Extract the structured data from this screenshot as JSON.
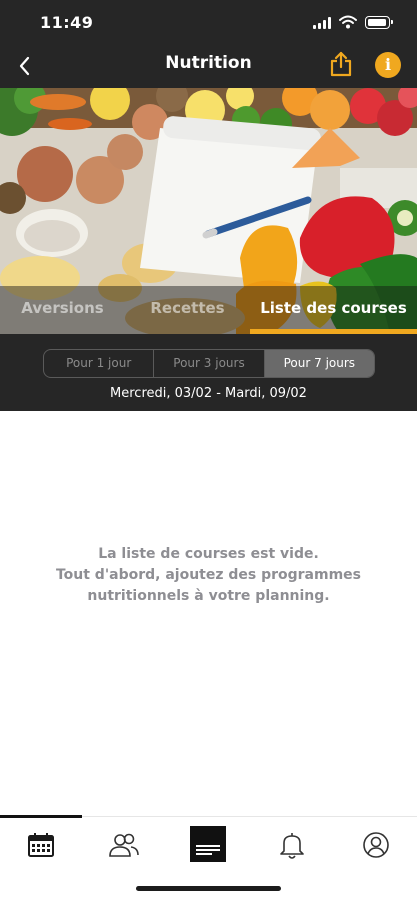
{
  "status_bar": {
    "time": "11:49"
  },
  "header": {
    "title": "Nutrition",
    "back_icon": "chevron-left-icon",
    "share_icon": "share-icon",
    "info_icon": "info-icon",
    "info_glyph": "i",
    "accent_color": "#f0a81f"
  },
  "tabs": [
    {
      "label": "Aversions",
      "selected": false
    },
    {
      "label": "Recettes",
      "selected": false
    },
    {
      "label": "Liste des courses",
      "selected": true
    }
  ],
  "period_selector": {
    "options": [
      "Pour 1 jour",
      "Pour 3 jours",
      "Pour 7 jours"
    ],
    "selected": "Pour 7 jours"
  },
  "date_range": "Mercredi, 03/02 - Mardi, 09/02",
  "empty_state": {
    "lines": [
      "La liste de courses est vide.",
      "Tout d'abord, ajoutez des programmes",
      "nutritionnels à votre planning."
    ]
  },
  "tab_bar": {
    "items": [
      {
        "icon": "calendar-icon",
        "selected": true
      },
      {
        "icon": "users-icon",
        "selected": false
      },
      {
        "icon": "menu-card-icon",
        "selected": false
      },
      {
        "icon": "bell-icon",
        "selected": false
      },
      {
        "icon": "profile-icon",
        "selected": false
      }
    ]
  }
}
